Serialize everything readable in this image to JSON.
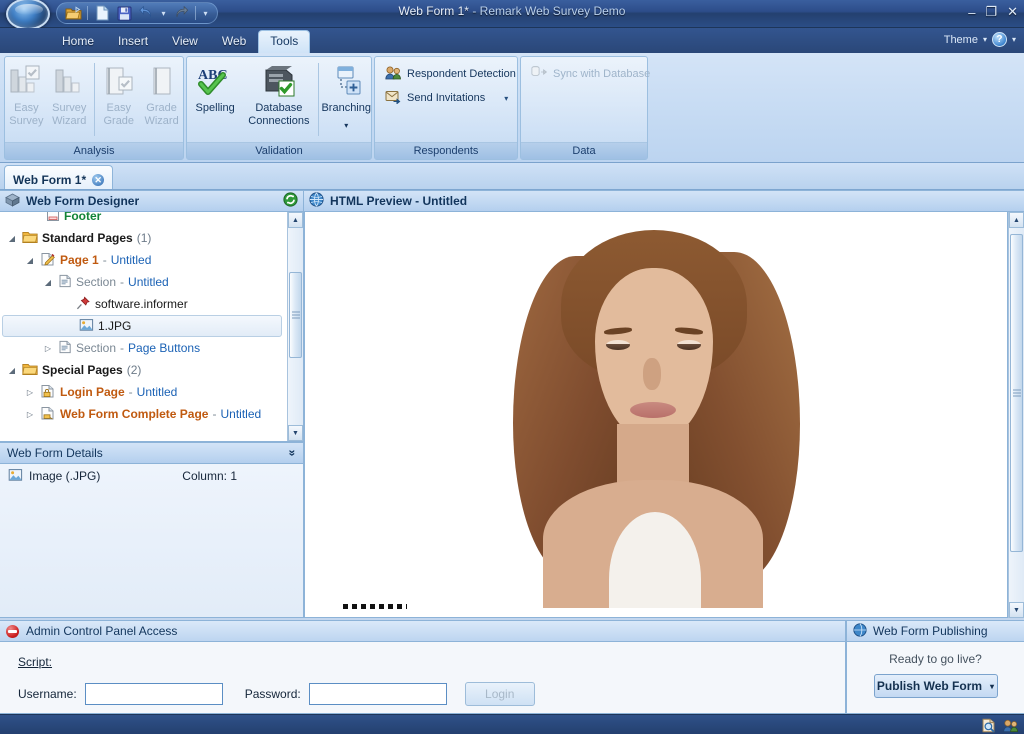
{
  "window": {
    "title": "Web Form 1*",
    "subtitle": " - Remark Web Survey Demo",
    "minimize": "–",
    "maximize": "❐",
    "close": "✕"
  },
  "quick_access": {
    "items": [
      {
        "name": "open-icon",
        "glyph": "📂"
      },
      {
        "name": "new-document-icon",
        "glyph": "🗋"
      },
      {
        "name": "save-icon",
        "glyph": "💾"
      },
      {
        "name": "undo-icon",
        "glyph": "↶"
      },
      {
        "name": "redo-icon",
        "glyph": "↷"
      }
    ],
    "undo_caret": "▾",
    "customize_caret": "▾"
  },
  "ribbon": {
    "tabs": [
      {
        "label": "Home",
        "active": false
      },
      {
        "label": "Insert",
        "active": false
      },
      {
        "label": "View",
        "active": false
      },
      {
        "label": "Web",
        "active": false
      },
      {
        "label": "Tools",
        "active": true
      }
    ],
    "theme_label": "Theme",
    "theme_caret": "▾",
    "help_glyph": "?",
    "help_caret": "▾",
    "groups": [
      {
        "title": "Analysis",
        "buttons": [
          {
            "label_line1": "Easy",
            "label_line2": "Survey",
            "disabled": true
          },
          {
            "label_line1": "Survey",
            "label_line2": "Wizard",
            "disabled": true
          },
          {
            "label_line1": "Easy",
            "label_line2": "Grade",
            "disabled": true
          },
          {
            "label_line1": "Grade",
            "label_line2": "Wizard",
            "disabled": true
          }
        ]
      },
      {
        "title": "Validation",
        "buttons": [
          {
            "label_line1": "Spelling",
            "label_line2": "",
            "disabled": false
          },
          {
            "label_line1": "Database",
            "label_line2": "Connections",
            "disabled": false
          },
          {
            "label_line1": "Branching",
            "label_line2": "",
            "disabled": false
          }
        ]
      },
      {
        "title": "Respondents",
        "small_buttons": [
          {
            "label": "Respondent Detection",
            "disabled": false,
            "caret": ""
          },
          {
            "label": "Send Invitations",
            "disabled": false,
            "caret": "▾"
          }
        ]
      },
      {
        "title": "Data",
        "small_buttons": [
          {
            "label": "Sync with Database",
            "disabled": true,
            "caret": ""
          }
        ]
      }
    ]
  },
  "document_tab": {
    "label": "Web Form 1*",
    "close_glyph": "✕"
  },
  "designer": {
    "header_title": "Web Form Designer",
    "refresh_icon": "↻",
    "tree": [
      {
        "indent": 1,
        "twisty": "",
        "icon": "footer-icon",
        "label": "Footer",
        "style": "green",
        "suffix": "",
        "count": "",
        "selected": false
      },
      {
        "indent": 0,
        "twisty": "◢",
        "icon": "folder-icon",
        "label": "Standard Pages",
        "style": "bold",
        "suffix": "",
        "count": "(1)",
        "selected": false
      },
      {
        "indent": 1,
        "twisty": "◢",
        "icon": "page-icon",
        "label": "Page 1",
        "style": "orange",
        "suffix": "Untitled",
        "count": "",
        "selected": false
      },
      {
        "indent": 2,
        "twisty": "◢",
        "icon": "section-icon",
        "label": "Section",
        "style": "gray",
        "suffix": "Untitled",
        "count": "",
        "selected": false
      },
      {
        "indent": 3,
        "twisty": "",
        "icon": "pin-icon",
        "label": "software.informer",
        "style": "plain",
        "suffix": "",
        "count": "",
        "selected": false
      },
      {
        "indent": 3,
        "twisty": "",
        "icon": "image-icon",
        "label": "1.JPG",
        "style": "plain",
        "suffix": "",
        "count": "",
        "selected": true
      },
      {
        "indent": 2,
        "twisty": "▷",
        "icon": "section-icon",
        "label": "Section",
        "style": "gray",
        "suffix": "Page Buttons",
        "count": "",
        "selected": false
      },
      {
        "indent": 0,
        "twisty": "◢",
        "icon": "folder-icon",
        "label": "Special Pages",
        "style": "bold",
        "suffix": "",
        "count": "(2)",
        "selected": false
      },
      {
        "indent": 1,
        "twisty": "▷",
        "icon": "login-page-icon",
        "label": "Login Page",
        "style": "orange",
        "suffix": "Untitled",
        "count": "",
        "selected": false
      },
      {
        "indent": 1,
        "twisty": "▷",
        "icon": "complete-page-icon",
        "label": "Web Form Complete Page",
        "style": "orange",
        "suffix": "Untitled",
        "count": "",
        "selected": false
      }
    ],
    "separator": "-"
  },
  "details": {
    "header_title": "Web Form Details",
    "collapse_caret": "»",
    "row_icon": "image-icon",
    "row_label": "Image (.JPG)",
    "row_value": "Column: 1"
  },
  "preview": {
    "header_title": "HTML Preview - Untitled",
    "globe_icon": "globe-icon"
  },
  "admin_panel": {
    "header_title": "Admin Control Panel Access",
    "script_label": "Script:",
    "username_label": "Username:",
    "username_value": "",
    "password_label": "Password:",
    "password_value": "",
    "login_label": "Login"
  },
  "publishing": {
    "header_title": "Web Form Publishing",
    "ready_label": "Ready to go live?",
    "publish_label": "Publish Web Form",
    "publish_caret": "▾"
  },
  "status_bar": {
    "icons": [
      {
        "name": "preview-icon"
      },
      {
        "name": "respondents-icon"
      }
    ]
  },
  "scroll": {
    "up_arrow": "▲",
    "down_arrow": "▼",
    "left_arrow": "◀",
    "right_arrow": "▶"
  },
  "colors": {
    "accent_blue": "#2d4d8a",
    "tab_active": "#e9f3fc",
    "tree_orange": "#c05a10",
    "tree_blue": "#1b62b5",
    "tree_green": "#128437",
    "photo_background": "#bd3d66"
  }
}
